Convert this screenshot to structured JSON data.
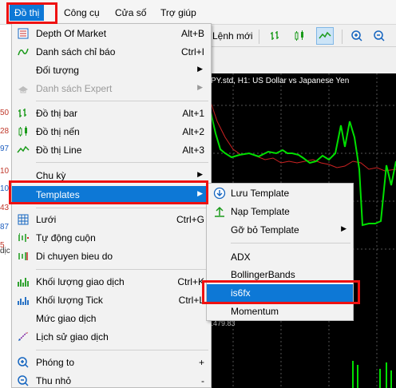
{
  "menubar": {
    "items": [
      "Đồ thị",
      "Công cụ",
      "Cửa số",
      "Trợ giúp"
    ]
  },
  "toolbar": {
    "new_order_label": "Lệnh mới"
  },
  "chart": {
    "title": "PY.std, H1: US Dollar vs Japanese Yen",
    "price_readout": "1479.83"
  },
  "left_strip": {
    "values": [
      "50",
      "28",
      "97",
      "10",
      "10",
      "43",
      "87",
      "5",
      "dịc"
    ]
  },
  "dropdown": {
    "items": [
      {
        "label": "Depth Of Market",
        "shortcut": "Alt+B"
      },
      {
        "label": "Danh sách chỉ báo",
        "shortcut": "Ctrl+I"
      },
      {
        "label": "Đối tượng",
        "arrow": "▶"
      },
      {
        "label": "Danh sách Expert",
        "arrow": "▶"
      },
      {
        "label": "Đồ thị bar",
        "shortcut": "Alt+1"
      },
      {
        "label": "Đồ thị nến",
        "shortcut": "Alt+2"
      },
      {
        "label": "Đồ thị Line",
        "shortcut": "Alt+3"
      },
      {
        "label": "Chu kỳ",
        "arrow": "▶"
      },
      {
        "label": "Templates",
        "arrow": "▶"
      },
      {
        "label": "Lưới",
        "shortcut": "Ctrl+G"
      },
      {
        "label": "Tự động cuộn"
      },
      {
        "label": "Di chuyen bieu do"
      },
      {
        "label": "Khối lượng giao dịch",
        "shortcut": "Ctrl+K"
      },
      {
        "label": "Khối lượng Tick",
        "shortcut": "Ctrl+L"
      },
      {
        "label": "Mức giao dịch"
      },
      {
        "label": "Lịch sử giao dịch"
      },
      {
        "label": "Phóng to",
        "shortcut": "+"
      },
      {
        "label": "Thu nhỏ",
        "shortcut": "-"
      }
    ]
  },
  "submenu": {
    "items": [
      {
        "label": "Lưu Template"
      },
      {
        "label": "Nạp Template"
      },
      {
        "label": "Gỡ bỏ Template",
        "arrow": "▶"
      },
      {
        "label": "ADX"
      },
      {
        "label": "BollingerBands"
      },
      {
        "label": "is6fx"
      },
      {
        "label": "Momentum"
      }
    ]
  },
  "colors": {
    "accent": "#0d78d6",
    "highlight_box": "#ee1111",
    "chart_bg": "#000000",
    "chart_line": "#00e000",
    "chart_ma": "#cc2222"
  }
}
